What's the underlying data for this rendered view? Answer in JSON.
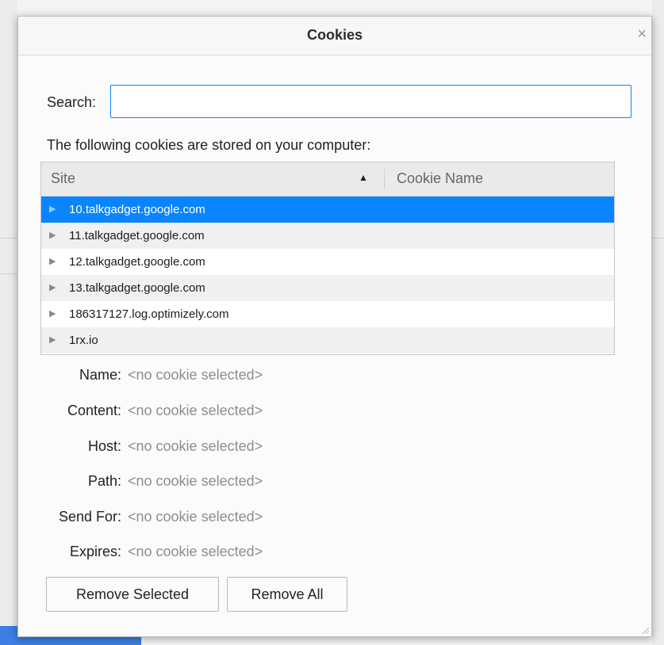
{
  "dialog": {
    "title": "Cookies",
    "close_glyph": "×"
  },
  "search": {
    "label": "Search:",
    "value": "",
    "placeholder": ""
  },
  "description": "The following cookies are stored on your computer:",
  "table": {
    "columns": {
      "site": "Site",
      "cookie_name": "Cookie Name"
    },
    "sort_indicator": "▲",
    "rows": [
      {
        "site": "10.talkgadget.google.com",
        "selected": true
      },
      {
        "site": "11.talkgadget.google.com",
        "selected": false
      },
      {
        "site": "12.talkgadget.google.com",
        "selected": false
      },
      {
        "site": "13.talkgadget.google.com",
        "selected": false
      },
      {
        "site": "186317127.log.optimizely.com",
        "selected": false
      },
      {
        "site": "1rx.io",
        "selected": false
      }
    ],
    "twisty_glyph": "▶"
  },
  "details": {
    "name": {
      "label": "Name:",
      "value": "<no cookie selected>"
    },
    "content": {
      "label": "Content:",
      "value": "<no cookie selected>"
    },
    "host": {
      "label": "Host:",
      "value": "<no cookie selected>"
    },
    "path": {
      "label": "Path:",
      "value": "<no cookie selected>"
    },
    "send_for": {
      "label": "Send For:",
      "value": "<no cookie selected>"
    },
    "expires": {
      "label": "Expires:",
      "value": "<no cookie selected>"
    }
  },
  "buttons": {
    "remove_selected": "Remove Selected",
    "remove_all": "Remove All"
  },
  "colors": {
    "accent": "#0a84ff",
    "selection": "#0a84ff",
    "muted_text": "#8d8d8d"
  }
}
